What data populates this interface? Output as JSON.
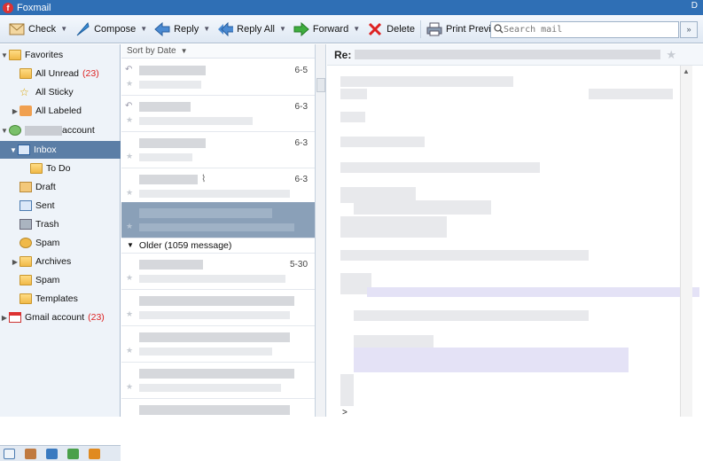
{
  "window": {
    "title": "Foxmail",
    "control": "D"
  },
  "toolbar": {
    "check": "Check",
    "compose": "Compose",
    "reply": "Reply",
    "reply_all": "Reply All",
    "forward": "Forward",
    "delete": "Delete",
    "print_preview": "Print Preview"
  },
  "search": {
    "placeholder": "Search mail"
  },
  "sidebar": {
    "favorites": "Favorites",
    "all_unread": "All Unread",
    "all_unread_count": "(23)",
    "all_sticky": "All Sticky",
    "all_labeled": "All Labeled",
    "account": "account",
    "inbox": "Inbox",
    "todo": "To Do",
    "draft": "Draft",
    "sent": "Sent",
    "trash": "Trash",
    "spam": "Spam",
    "archives": "Archives",
    "spam2": "Spam",
    "templates": "Templates",
    "gmail": "Gmail account",
    "gmail_count": "(23)"
  },
  "list": {
    "sort": "Sort by Date",
    "older": "Older (1059 message)",
    "dates": [
      "6-5",
      "6-3",
      "6-3",
      "6-3",
      "5-30"
    ]
  },
  "preview": {
    "subject_prefix": "Re:",
    "quote_char": ">"
  },
  "colors": {
    "accent": "#2f6fb5",
    "selection": "#5b7ea6",
    "count": "#dd2222"
  }
}
